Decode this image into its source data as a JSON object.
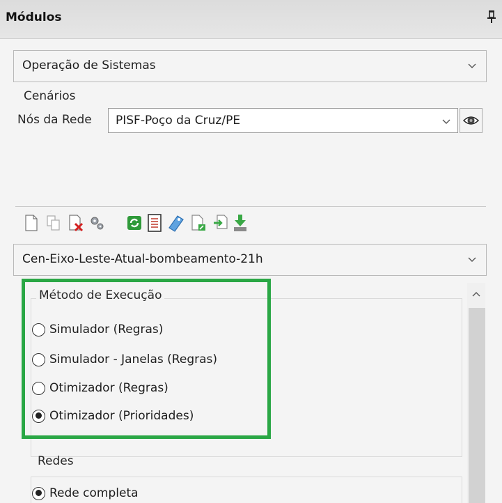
{
  "window": {
    "title": "Módulos"
  },
  "module_select": {
    "value": "Operação de Sistemas"
  },
  "scenarios": {
    "label": "Cenários",
    "network_nodes_label": "Nós da Rede",
    "network_nodes_value": "PISF-Poço da Cruz/PE"
  },
  "toolbar": {
    "icons": [
      "new-document-icon",
      "copy-icon",
      "delete-icon",
      "settings-icon",
      "refresh-icon",
      "list-icon",
      "tag-icon",
      "import-icon",
      "export-icon",
      "download-icon"
    ]
  },
  "scenario_select": {
    "value": "Cen-Eixo-Leste-Atual-bombeamento-21h"
  },
  "execution_method": {
    "label": "Método de Execução",
    "options": [
      {
        "label": "Simulador (Regras)",
        "checked": false
      },
      {
        "label": "Simulador - Janelas (Regras)",
        "checked": false
      },
      {
        "label": "Otimizador (Regras)",
        "checked": false
      },
      {
        "label": "Otimizador (Prioridades)",
        "checked": true
      }
    ]
  },
  "networks": {
    "label": "Redes",
    "options": [
      {
        "label": "Rede completa",
        "checked": true
      }
    ]
  },
  "colors": {
    "highlight": "#2aa745"
  }
}
